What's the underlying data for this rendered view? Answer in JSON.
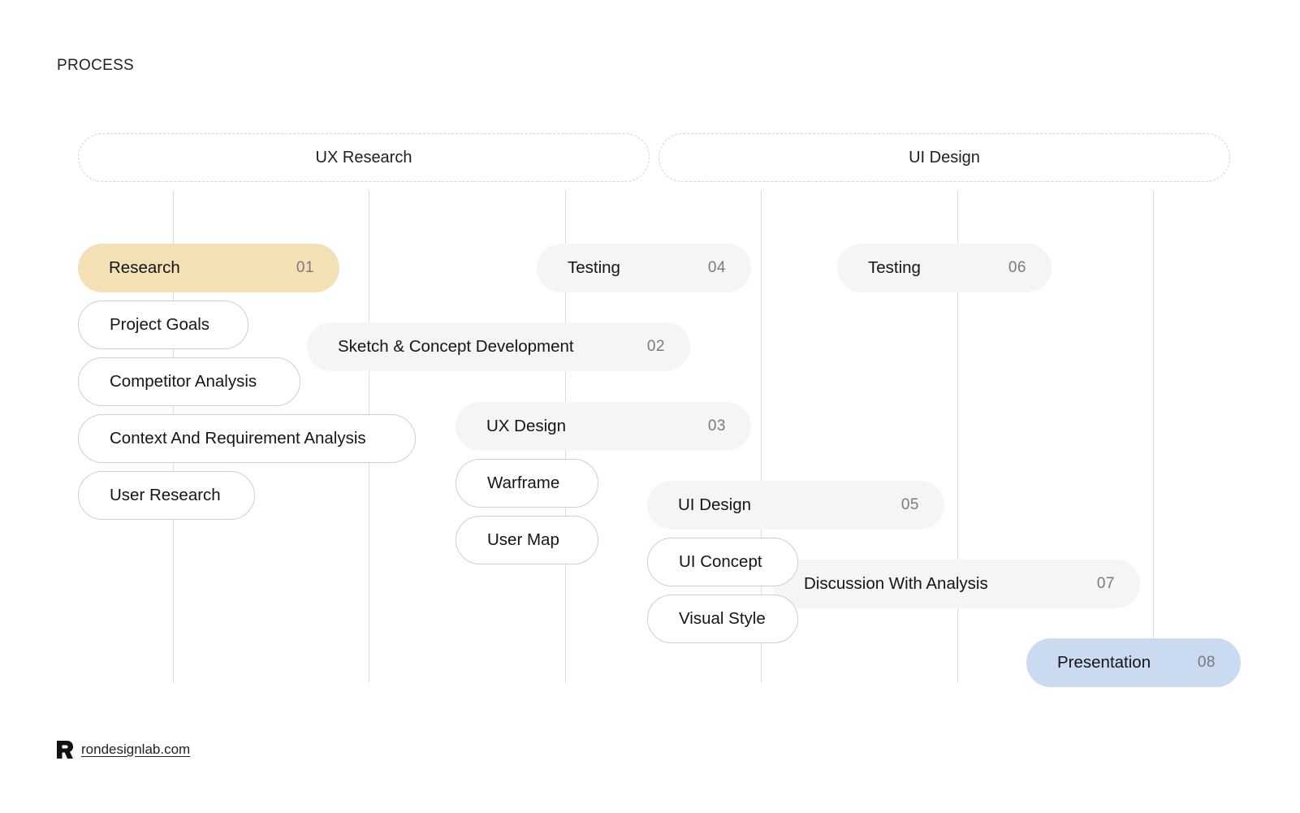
{
  "page": {
    "title": "PROCESS"
  },
  "phases": [
    {
      "label": "UX Research"
    },
    {
      "label": "UI Design"
    }
  ],
  "stages": [
    {
      "label": "Research",
      "number": "01",
      "color": "#f3e0b5"
    },
    {
      "label": "Sketch & Concept Development",
      "number": "02",
      "color": "#f5f5f5"
    },
    {
      "label": "UX Design",
      "number": "03",
      "color": "#f5f5f5"
    },
    {
      "label": "Testing",
      "number": "04",
      "color": "#f5f5f5"
    },
    {
      "label": "UI Design",
      "number": "05",
      "color": "#f5f5f5"
    },
    {
      "label": "Testing",
      "number": "06",
      "color": "#f5f5f5"
    },
    {
      "label": "Discussion With Analysis",
      "number": "07",
      "color": "#f5f5f5"
    },
    {
      "label": "Presentation",
      "number": "08",
      "color": "#c9daf1"
    }
  ],
  "subtasks": {
    "research": [
      "Project Goals",
      "Competitor Analysis",
      "Context And Requirement Analysis",
      "User Research"
    ],
    "ux_design": [
      "Warframe",
      "User Map"
    ],
    "ui_design": [
      "UI Concept",
      "Visual Style"
    ]
  },
  "footer": {
    "logo_icon": "r-logo-icon",
    "link": "rondesignlab.com"
  }
}
